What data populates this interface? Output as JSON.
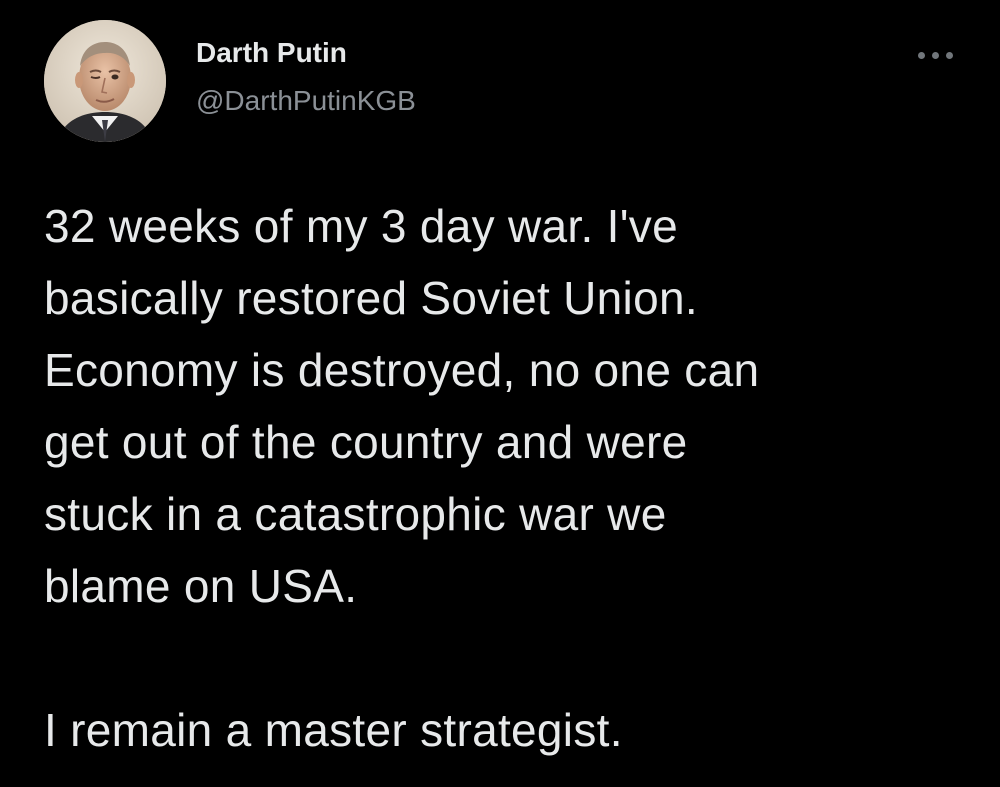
{
  "user": {
    "display_name": "Darth Putin",
    "handle": "@DarthPutinKGB",
    "avatar_icon": "profile-photo"
  },
  "more_icon": "more-horizontal-icon",
  "tweet": {
    "lines": [
      "32 weeks of my 3 day war. I've",
      "basically restored Soviet Union.",
      "Economy is destroyed, no one can",
      "get out of the country and were",
      "stuck in a catastrophic war we",
      "blame on USA."
    ],
    "closing_line": "I remain a master strategist."
  },
  "colors": {
    "background": "#000000",
    "text_primary": "#e7e9ea",
    "text_secondary": "#8b9096"
  }
}
